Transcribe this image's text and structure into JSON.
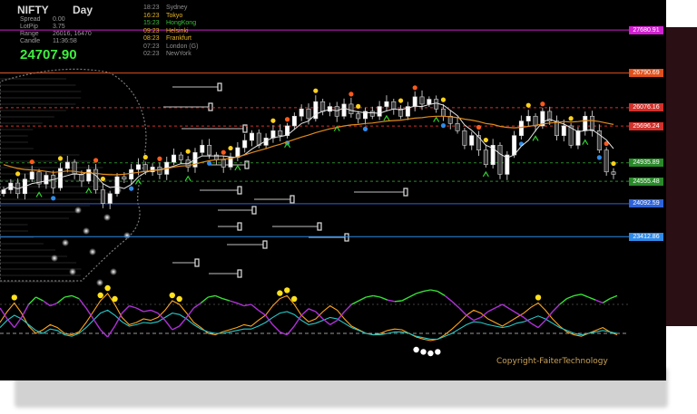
{
  "header": {
    "symbol": "NIFTY",
    "timeframe": "Day",
    "spread_label": "Spread",
    "spread_value": "0.00",
    "lotpip_label": "LotPip",
    "lotpip_value": "3.75",
    "range_label": "Range",
    "range_value": "26016, 16470",
    "candle_label": "Candle",
    "candle_value": "11:36:58",
    "price": "24707.90"
  },
  "sessions": [
    {
      "time": "18:23",
      "name": "Sydney",
      "color": "#8e8e8e"
    },
    {
      "time": "16:23",
      "name": "Tokyo",
      "color": "#e6b422"
    },
    {
      "time": "15:23",
      "name": "HongKong",
      "color": "#36c236"
    },
    {
      "time": "09:23",
      "name": "Helsinki",
      "color": "#e6b422"
    },
    {
      "time": "08:23",
      "name": "Frankfurt",
      "color": "#e6b422"
    },
    {
      "time": "07:23",
      "name": "London  (G)",
      "color": "#8e8e8e"
    },
    {
      "time": "02:23",
      "name": "NewYork",
      "color": "#8e8e8e"
    }
  ],
  "levels": [
    {
      "label": "27680.91",
      "value": 27680.91,
      "color": "#d21fd2",
      "style": "solid"
    },
    {
      "label": "26790.69",
      "value": 26790.69,
      "color": "#e0501c",
      "style": "solid"
    },
    {
      "label": "26076.16",
      "value": 26076.16,
      "color": "#d2302a",
      "style": "dashed"
    },
    {
      "label": "25696.24",
      "value": 25696.24,
      "color": "#d2302a",
      "style": "dashed"
    },
    {
      "label": "24935.89",
      "value": 24935.89,
      "color": "#2a8a2a",
      "style": "dashed"
    },
    {
      "label": "24555.48",
      "value": 24555.48,
      "color": "#2a8a2a",
      "style": "dashed"
    },
    {
      "label": "24092.59",
      "value": 24092.59,
      "color": "#2f62d8",
      "style": "solid"
    },
    {
      "label": "23412.86",
      "value": 23412.86,
      "color": "#2f8ae8",
      "style": "solid"
    }
  ],
  "copyright": "Copyright-FaiterTechnology",
  "chart_data": {
    "type": "line",
    "title": "NIFTY Day",
    "ylim": [
      22500,
      28300
    ],
    "series": [
      {
        "values": [
          24380,
          24520,
          24300,
          24600,
          24750,
          24500,
          24680,
          24420,
          24820,
          24950,
          24700,
          24560,
          24800,
          24380,
          24100,
          24300,
          24650,
          24600,
          24800,
          24900,
          24750,
          24850,
          24700,
          24950,
          25100,
          25000,
          24850,
          25150,
          25300,
          25100,
          25000,
          24850,
          25050,
          25250,
          25400,
          25550,
          25300,
          25450,
          25600,
          25500,
          25700,
          25900,
          26050,
          25850,
          26200,
          26000,
          26100,
          25900,
          26150,
          25950,
          25850,
          26000,
          25900,
          26100,
          26200,
          26050,
          25900,
          26100,
          26300,
          26150,
          26250,
          26050,
          25900,
          25750,
          25600,
          25300,
          25500,
          25200,
          24900,
          25300,
          24700,
          25100,
          25500,
          25800,
          25900,
          25700,
          26000,
          25800,
          25500,
          25700,
          25300,
          25600,
          25900,
          25600,
          25200,
          24750,
          24700
        ]
      },
      {
        "values": [
          24900,
          24860,
          24820,
          24800,
          24790,
          24780,
          24760,
          24740,
          24750,
          24770,
          24760,
          24740,
          24730,
          24720,
          24700,
          24690,
          24690,
          24700,
          24720,
          24740,
          24760,
          24780,
          24790,
          24820,
          24850,
          24870,
          24880,
          24910,
          24950,
          24980,
          25000,
          25010,
          25030,
          25060,
          25100,
          25150,
          25190,
          25230,
          25280,
          25320,
          25370,
          25420,
          25470,
          25510,
          25560,
          25600,
          25640,
          25670,
          25700,
          25720,
          25730,
          25750,
          25760,
          25780,
          25800,
          25810,
          25820,
          25840,
          25860,
          25870,
          25890,
          25900,
          25900,
          25890,
          25870,
          25840,
          25820,
          25790,
          25750,
          25730,
          25690,
          25670,
          25660,
          25670,
          25690,
          25710,
          25740,
          25760,
          25770,
          25790,
          25780,
          25790,
          25810,
          25810,
          25790,
          25760,
          25730
        ]
      }
    ],
    "oscillator": {
      "ylim": [
        0,
        100
      ],
      "series": [
        {
          "color": "#ffa51c",
          "values": [
            45,
            60,
            72,
            58,
            40,
            30,
            35,
            42,
            38,
            30,
            28,
            32,
            45,
            60,
            75,
            85,
            70,
            52,
            42,
            45,
            50,
            48,
            52,
            62,
            75,
            70,
            58,
            45,
            38,
            30,
            28,
            32,
            35,
            38,
            42,
            40,
            48,
            55,
            68,
            78,
            82,
            70,
            55,
            46,
            50,
            60,
            68,
            62,
            50,
            40,
            35,
            30,
            28,
            30,
            34,
            36,
            35,
            30,
            25,
            22,
            20,
            22,
            28,
            36,
            45,
            55,
            62,
            58,
            50,
            45,
            40,
            46,
            52,
            58,
            66,
            72,
            62,
            50,
            40,
            32,
            28,
            26,
            30,
            34,
            38,
            32,
            28
          ]
        },
        {
          "color": "#28c8c8",
          "values": [
            38,
            48,
            55,
            50,
            42,
            34,
            30,
            36,
            34,
            28,
            26,
            30,
            38,
            48,
            58,
            62,
            55,
            46,
            40,
            42,
            45,
            44,
            46,
            52,
            58,
            56,
            50,
            42,
            36,
            32,
            30,
            30,
            32,
            34,
            36,
            36,
            40,
            45,
            52,
            58,
            60,
            56,
            48,
            42,
            44,
            48,
            52,
            50,
            44,
            38,
            34,
            30,
            28,
            28,
            30,
            32,
            32,
            30,
            26,
            24,
            22,
            22,
            26,
            30,
            36,
            42,
            46,
            45,
            42,
            40,
            38,
            40,
            44,
            46,
            50,
            54,
            50,
            44,
            38,
            34,
            30,
            28,
            30,
            32,
            34,
            32,
            30
          ]
        }
      ]
    }
  }
}
